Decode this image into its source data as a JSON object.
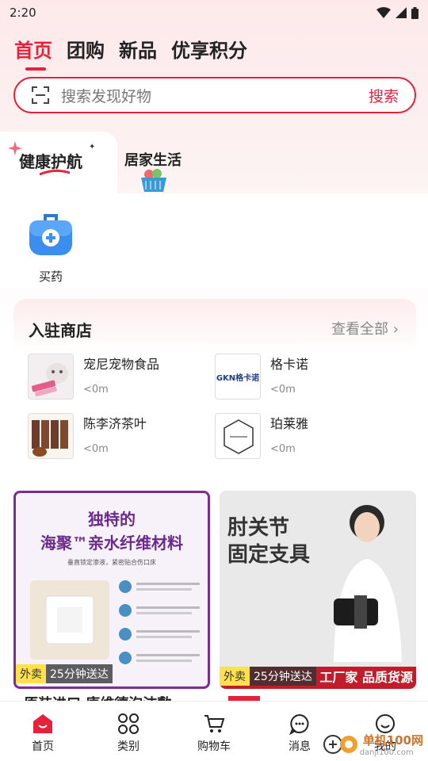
{
  "status": {
    "time": "2:20"
  },
  "top_tabs": [
    {
      "label": "首页",
      "active": true
    },
    {
      "label": "团购",
      "active": false
    },
    {
      "label": "新品",
      "active": false
    },
    {
      "label": "优享积分",
      "active": false
    }
  ],
  "search": {
    "placeholder": "搜索发现好物",
    "button": "搜索"
  },
  "category_tabs": [
    {
      "label": "健康护航",
      "active": true
    },
    {
      "label": "居家生活",
      "active": false
    }
  ],
  "shortcut": {
    "label": "买药",
    "icon": "medicine-box-icon"
  },
  "stores": {
    "title": "入驻商店",
    "view_all": "查看全部",
    "items": [
      {
        "name": "宠尼宠物食品",
        "distance": "<0m"
      },
      {
        "name": "格卡诺",
        "distance": "<0m",
        "logo_text": "GKN格卡诺"
      },
      {
        "name": "陈李济茶叶",
        "distance": "<0m"
      },
      {
        "name": "珀莱雅",
        "distance": "<0m"
      }
    ]
  },
  "products": [
    {
      "image_title_line1": "独特的",
      "image_title_line2": "海聚™亲水纤维材料",
      "image_subtitle": "垂直锁定渗液，紧密贴合伤口床",
      "badge_tag": "外卖",
      "badge_time": "25分钟送达",
      "caption": "原装进口 康维德泡沫敷"
    },
    {
      "image_title_line1": "肘关节",
      "image_title_line2": "固定支具",
      "banner_text": "工厂家 品质货源",
      "badge_tag": "外卖",
      "badge_time": "25分钟送达",
      "caption": ""
    }
  ],
  "bottom_nav": [
    {
      "label": "首页",
      "icon": "home-icon",
      "active": true
    },
    {
      "label": "类别",
      "icon": "grid-icon",
      "active": false
    },
    {
      "label": "购物车",
      "icon": "cart-icon",
      "active": false
    },
    {
      "label": "消息",
      "icon": "chat-icon",
      "active": false
    },
    {
      "label": "我的",
      "icon": "user-icon",
      "active": false
    }
  ],
  "watermark": {
    "text": "单机100网",
    "sub": "danji100.com"
  },
  "colors": {
    "accent": "#e8213a",
    "purple": "#6a2a8d"
  }
}
